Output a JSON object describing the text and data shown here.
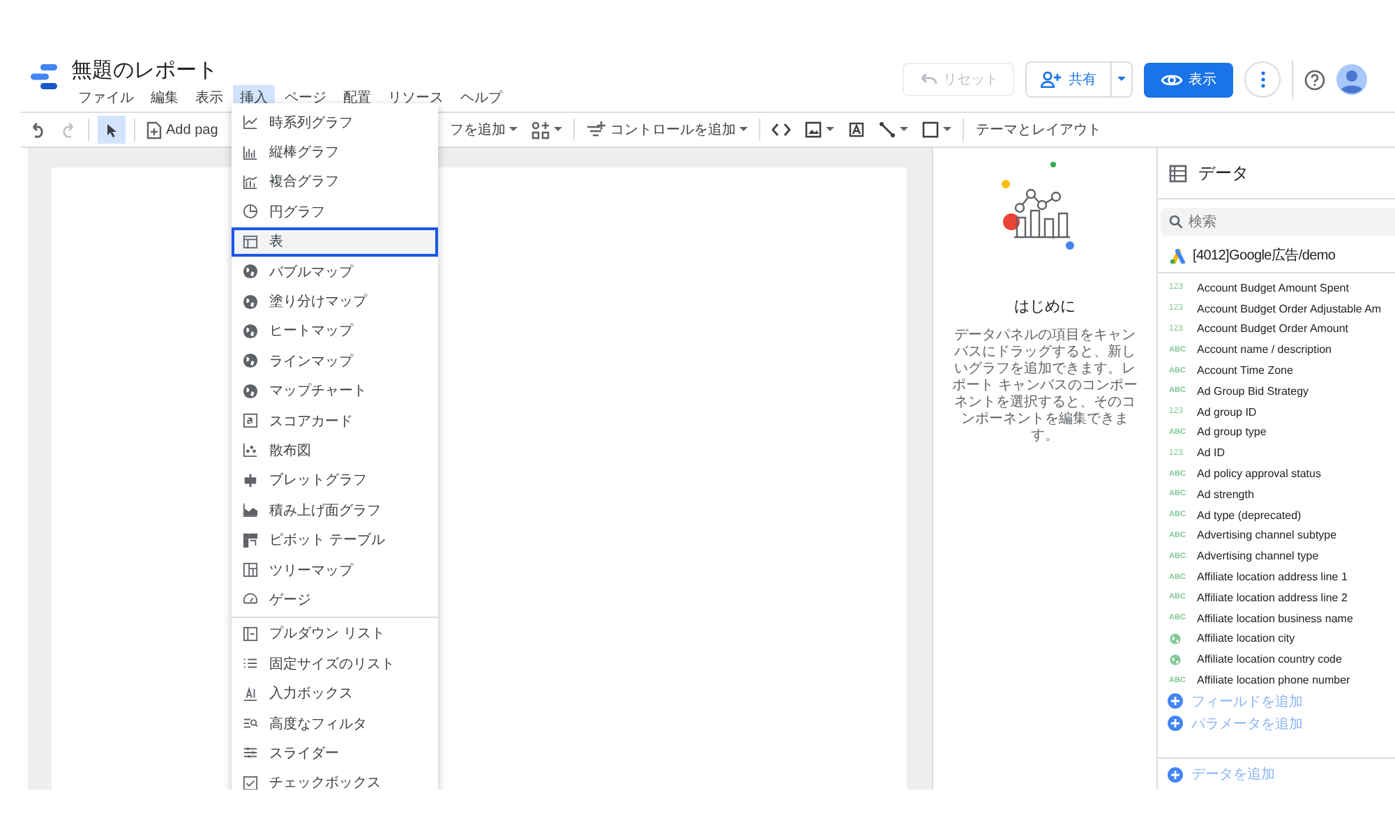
{
  "title": "無題のレポート",
  "menubar": [
    {
      "label": "ファイル",
      "selected": false
    },
    {
      "label": "編集",
      "selected": false
    },
    {
      "label": "表示",
      "selected": false
    },
    {
      "label": "挿入",
      "selected": true
    },
    {
      "label": "ページ",
      "selected": false
    },
    {
      "label": "配置",
      "selected": false
    },
    {
      "label": "リソース",
      "selected": false
    },
    {
      "label": "ヘルプ",
      "selected": false
    }
  ],
  "header_buttons": {
    "reset": {
      "label": "リセット",
      "disabled": true
    },
    "share": "共有",
    "view": "表示"
  },
  "toolbar": {
    "add_page": "Add pag",
    "add_chart": "フを追加",
    "add_control": "コントロールを追加",
    "theme": "テーマとレイアウト"
  },
  "insert_menu": {
    "charts": [
      {
        "kind": "timeseries",
        "label": "時系列グラフ",
        "selected": false
      },
      {
        "kind": "bar",
        "label": "縦棒グラフ",
        "selected": false
      },
      {
        "kind": "combo",
        "label": "複合グラフ",
        "selected": false
      },
      {
        "kind": "pie",
        "label": "円グラフ",
        "selected": false
      },
      {
        "kind": "table",
        "label": "表",
        "selected": true
      },
      {
        "kind": "geo",
        "label": "バブルマップ",
        "selected": false
      },
      {
        "kind": "geo",
        "label": "塗り分けマップ",
        "selected": false
      },
      {
        "kind": "geo",
        "label": "ヒートマップ",
        "selected": false
      },
      {
        "kind": "geo",
        "label": "ラインマップ",
        "selected": false
      },
      {
        "kind": "geo",
        "label": "マップチャート",
        "selected": false
      },
      {
        "kind": "scorecard",
        "label": "スコアカード",
        "selected": false
      },
      {
        "kind": "scatter",
        "label": "散布図",
        "selected": false
      },
      {
        "kind": "bullet",
        "label": "ブレットグラフ",
        "selected": false
      },
      {
        "kind": "area",
        "label": "積み上げ面グラフ",
        "selected": false
      },
      {
        "kind": "pivot",
        "label": "ピボット テーブル",
        "selected": false
      },
      {
        "kind": "treemap",
        "label": "ツリーマップ",
        "selected": false
      },
      {
        "kind": "gauge",
        "label": "ゲージ",
        "selected": false
      }
    ],
    "controls": [
      {
        "kind": "dropdown",
        "label": "プルダウン リスト",
        "selected": false
      },
      {
        "kind": "list",
        "label": "固定サイズのリスト",
        "selected": false
      },
      {
        "kind": "input",
        "label": "入力ボックス",
        "selected": false
      },
      {
        "kind": "filter",
        "label": "高度なフィルタ",
        "selected": false
      },
      {
        "kind": "slider",
        "label": "スライダー",
        "selected": false
      },
      {
        "kind": "checkbox",
        "label": "チェックボックス",
        "selected": false
      }
    ]
  },
  "intro": {
    "title": "はじめに",
    "text": "データパネルの項目をキャンバスにドラッグすると、新しいグラフを追加できます。レポート キャンバスのコンポーネントを選択すると、そのコンポーネントを編集できます。"
  },
  "data_panel": {
    "title": "データ",
    "search": {
      "placeholder": "検索"
    },
    "source": "[4012]Google広告/demo",
    "fields": [
      {
        "kind": "number",
        "type_label": "123",
        "name": "Account Budget Amount Spent"
      },
      {
        "kind": "number",
        "type_label": "123",
        "name": "Account Budget Order Adjustable Am"
      },
      {
        "kind": "number",
        "type_label": "123",
        "name": "Account Budget Order Amount"
      },
      {
        "kind": "text",
        "type_label": "ABC",
        "name": "Account name / description"
      },
      {
        "kind": "text",
        "type_label": "ABC",
        "name": "Account Time Zone"
      },
      {
        "kind": "text",
        "type_label": "ABC",
        "name": "Ad Group Bid Strategy"
      },
      {
        "kind": "number",
        "type_label": "123",
        "name": "Ad group ID"
      },
      {
        "kind": "text",
        "type_label": "ABC",
        "name": "Ad group type"
      },
      {
        "kind": "number",
        "type_label": "123",
        "name": "Ad ID"
      },
      {
        "kind": "text",
        "type_label": "ABC",
        "name": "Ad policy approval status"
      },
      {
        "kind": "text",
        "type_label": "ABC",
        "name": "Ad strength"
      },
      {
        "kind": "text",
        "type_label": "ABC",
        "name": "Ad type (deprecated)"
      },
      {
        "kind": "text",
        "type_label": "ABC",
        "name": "Advertising channel subtype"
      },
      {
        "kind": "text",
        "type_label": "ABC",
        "name": "Advertising channel type"
      },
      {
        "kind": "text",
        "type_label": "ABC",
        "name": "Affiliate location address line 1"
      },
      {
        "kind": "text",
        "type_label": "ABC",
        "name": "Affiliate location address line 2"
      },
      {
        "kind": "text",
        "type_label": "ABC",
        "name": "Affiliate location business name"
      },
      {
        "kind": "geo",
        "name": "Affiliate location city"
      },
      {
        "kind": "geo",
        "name": "Affiliate location country code"
      },
      {
        "kind": "text",
        "type_label": "ABC",
        "name": "Affiliate location phone number"
      }
    ],
    "add_field": "フィールドを追加",
    "add_parameter": "パラメータを追加",
    "add_data": "データを追加"
  }
}
